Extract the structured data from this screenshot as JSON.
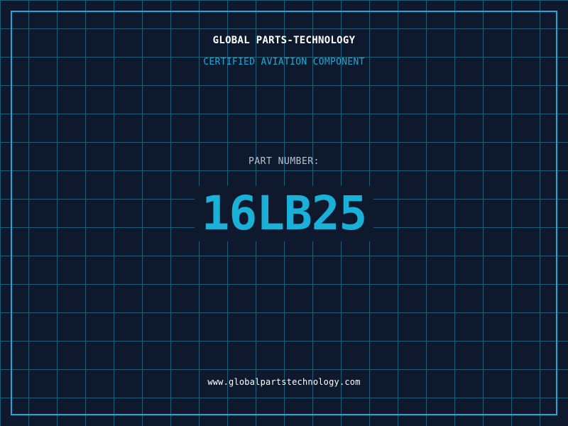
{
  "header": {
    "brand": "GLOBAL PARTS-TECHNOLOGY",
    "subtitle": "CERTIFIED AVIATION COMPONENT"
  },
  "main": {
    "part_label": "PART NUMBER:",
    "part_number": "16LB25"
  },
  "footer": {
    "url": "www.globalpartstechnology.com"
  },
  "colors": {
    "background": "#0f192e",
    "grid": "#1c5d78",
    "accent": "#1fa9d4",
    "part_number": "#1ab1d9",
    "label": "#b8c2cf",
    "text": "#ffffff"
  }
}
